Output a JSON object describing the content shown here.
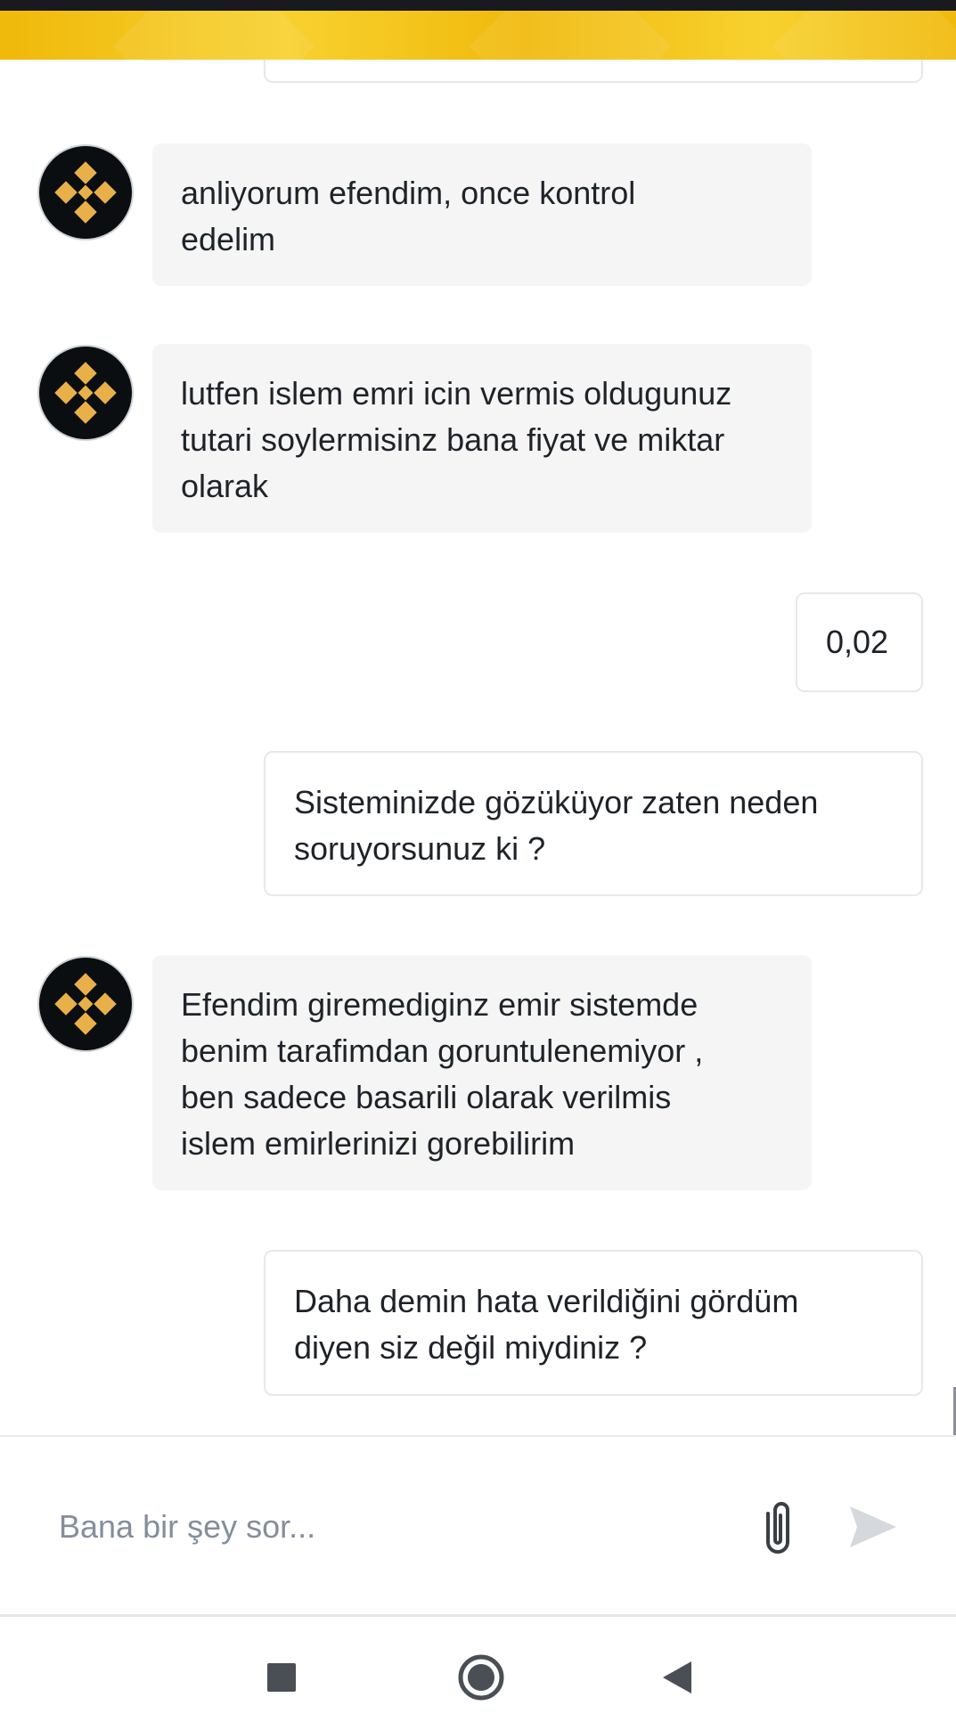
{
  "colors": {
    "brand_yellow": "#f0b90b",
    "bot_bubble": "#f5f5f5",
    "user_border": "#e6e8ea",
    "placeholder": "#848e9c"
  },
  "messages": [
    {
      "sender": "bot",
      "text": "anliyorum efendim, once kontrol\nedelim"
    },
    {
      "sender": "bot",
      "text": "lutfen islem emri icin vermis oldugunuz\ntutari soylermisinz bana fiyat ve miktar\nolarak"
    },
    {
      "sender": "user",
      "text": "0,02"
    },
    {
      "sender": "user",
      "text": "Sisteminizde gözüküyor zaten neden\nsoruyorsunuz ki ?"
    },
    {
      "sender": "bot",
      "text": "Efendim giremediginz emir sistemde\nbenim tarafimdan goruntulenemiyor ,\nben sadece basarili olarak verilmis\nislem emirlerinizi gorebilirim"
    },
    {
      "sender": "user",
      "text": "Daha demin hata verildiğini gördüm\ndiyen siz değil miydiniz ?"
    }
  ],
  "composer": {
    "placeholder": "Bana bir şey sor...",
    "value": "",
    "attach_icon": "paperclip-icon",
    "send_icon": "send-icon"
  },
  "navbar": {
    "icons": [
      "recent-apps-icon",
      "home-icon",
      "back-icon"
    ]
  }
}
